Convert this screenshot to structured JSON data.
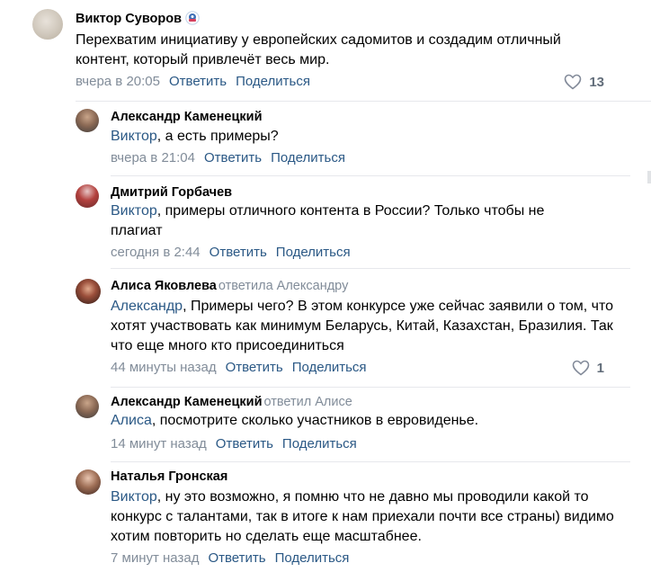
{
  "comments": [
    {
      "author": "Виктор Суворов",
      "replied_to": "",
      "mention": "",
      "text": "Перехватим инициативу у европейских садомитов и создадим отличный контент, который привлечёт весь мир.",
      "time": "вчера в 20:05",
      "reply_label": "Ответить",
      "share_label": "Поделиться",
      "likes": "13"
    },
    {
      "author": "Александр Каменецкий",
      "replied_to": "",
      "mention": "Виктор",
      "text": ", а есть примеры?",
      "time": "вчера в 21:04",
      "reply_label": "Ответить",
      "share_label": "Поделиться",
      "likes": ""
    },
    {
      "author": "Дмитрий Горбачев",
      "replied_to": "",
      "mention": "Виктор",
      "text": ", примеры отличного контента в России? Только чтобы не плагиат",
      "time": "сегодня в 2:44",
      "reply_label": "Ответить",
      "share_label": "Поделиться",
      "likes": ""
    },
    {
      "author": "Алиса Яковлева",
      "replied_to": "ответила Александру",
      "mention": "Александр",
      "text": ", Примеры чего? В этом конкурсе уже сейчас заявили о том, что хотят участвовать как минимум Беларусь, Китай, Казахстан, Бразилия. Так что еще много кто присоединиться",
      "time": "44 минуты назад",
      "reply_label": "Ответить",
      "share_label": "Поделиться",
      "likes": "1"
    },
    {
      "author": "Александр Каменецкий",
      "replied_to": "ответил Алисе",
      "mention": "Алиса",
      "text": ", посмотрите сколько участников в евровиденье.",
      "time": "14 минут назад",
      "reply_label": "Ответить",
      "share_label": "Поделиться",
      "likes": ""
    },
    {
      "author": "Наталья Гронская",
      "replied_to": "",
      "mention": "Виктор",
      "text": ", ну это возможно, я помню что не давно мы проводили какой то конкурс с талантами, так в итоге к нам приехали почти все страны) видимо хотим повторить но сделать еще масштабнее.",
      "time": "7 минут назад",
      "reply_label": "Ответить",
      "share_label": "Поделиться",
      "likes": ""
    }
  ],
  "colors": {
    "link": "#2a5885",
    "muted": "#818c99",
    "divider": "#e7e8ec"
  }
}
